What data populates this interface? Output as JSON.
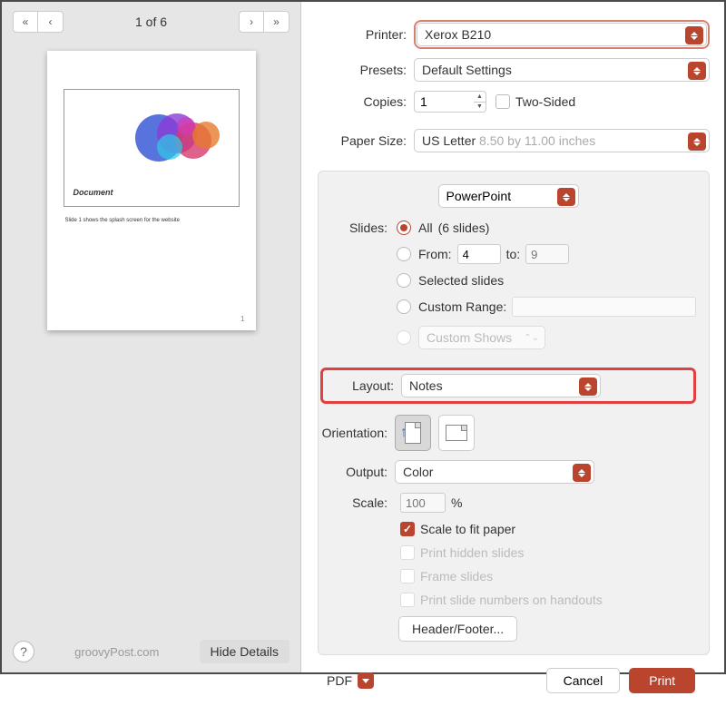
{
  "nav": {
    "page_indicator": "1 of 6"
  },
  "preview": {
    "slide_title": "Document",
    "notes": "Slide 1 shows the splash screen for the website",
    "page_num": "1"
  },
  "footer_left": {
    "watermark": "groovyPost.com",
    "hide_details": "Hide Details"
  },
  "labels": {
    "printer": "Printer:",
    "presets": "Presets:",
    "copies": "Copies:",
    "two_sided": "Two-Sided",
    "paper_size": "Paper Size:",
    "slides": "Slides:",
    "layout": "Layout:",
    "orientation": "Orientation:",
    "output": "Output:",
    "scale": "Scale:",
    "percent": "%"
  },
  "printer": {
    "value": "Xerox B210"
  },
  "presets": {
    "value": "Default Settings"
  },
  "copies": {
    "value": "1"
  },
  "paper_size": {
    "value": "US Letter",
    "dims": "8.50 by 11.00 inches"
  },
  "app_dropdown": {
    "value": "PowerPoint"
  },
  "slides": {
    "all_label": "All",
    "all_count": "(6 slides)",
    "from_label": "From:",
    "from_val": "4",
    "to_label": "to:",
    "to_val": "9",
    "selected": "Selected slides",
    "custom_range": "Custom Range:",
    "custom_shows": "Custom Shows"
  },
  "layout": {
    "value": "Notes"
  },
  "output": {
    "value": "Color"
  },
  "scale": {
    "value": "100"
  },
  "checks": {
    "fit": "Scale to fit paper",
    "hidden": "Print hidden slides",
    "frame": "Frame slides",
    "numbers": "Print slide numbers on handouts"
  },
  "header_footer": "Header/Footer...",
  "footer_right": {
    "pdf": "PDF",
    "cancel": "Cancel",
    "print": "Print"
  }
}
